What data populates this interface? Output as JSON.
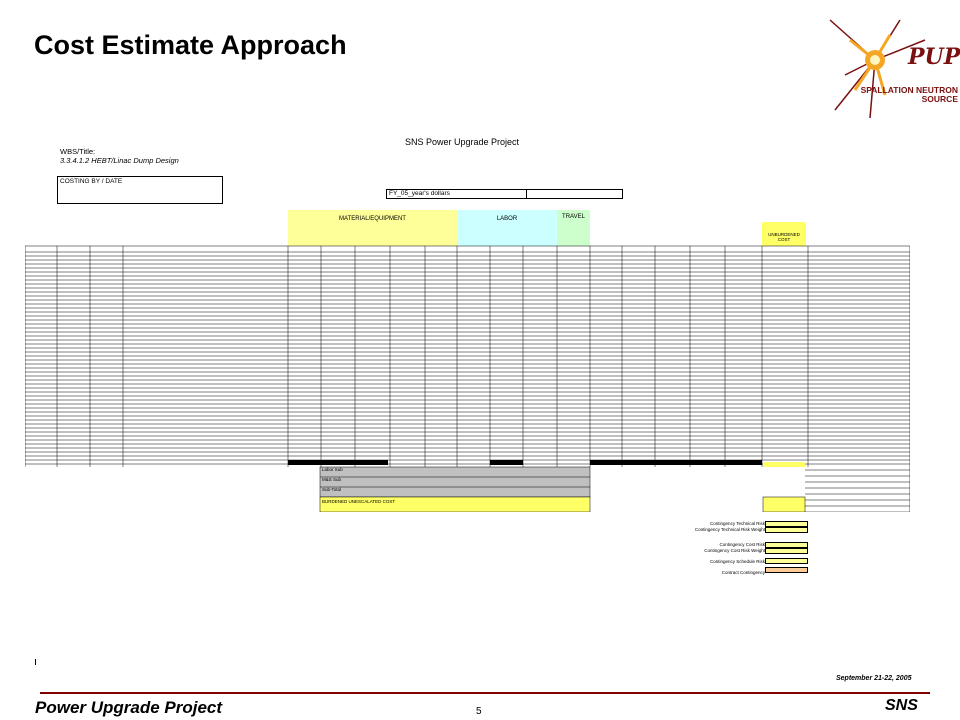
{
  "slide": {
    "title": "Cost Estimate Approach",
    "page_number": "5",
    "footer_left": "Power Upgrade Project",
    "footer_right": "SNS",
    "date": "September 21-22, 2005"
  },
  "logo": {
    "text_top": "PUP",
    "text_bottom": "SPALLATION NEUTRON SOURCE",
    "colors": {
      "burst": "#f5a623",
      "text": "#7a1010"
    }
  },
  "sheet": {
    "title": "SNS Power Upgrade Project",
    "wbs_label": "WBS/Title:",
    "wbs_value": "3.3.4.1.2 HEBT/Linac Dump Design",
    "costing_label": "COSTING BY / DATE",
    "fy_label": "FY_05_year's dollars",
    "groups": {
      "material": "MATERIAL/EQUIPMENT",
      "labor": "LABOR",
      "travel": "TRAVEL",
      "unburdened": "UNBURDENED COST"
    },
    "summary": {
      "row1": "Labor Sub",
      "row2": "M&S Sub",
      "row3": "Sub-Total",
      "row4": "BURDENED UNESCALATED COST"
    },
    "contingency": [
      "Contingency Technical Risk",
      "Contingency Technical Risk Weight",
      "Contingency Cost Risk",
      "Contingency Cost Risk Weight",
      "Contingency Schedule Risk",
      "Contract Contingency"
    ],
    "colors": {
      "yellow": "#ffff66",
      "light_yellow": "#ffff99",
      "cyan": "#ccffff",
      "green": "#ccffcc",
      "gray": "#c0c0c0",
      "salmon": "#ffcc99"
    }
  }
}
